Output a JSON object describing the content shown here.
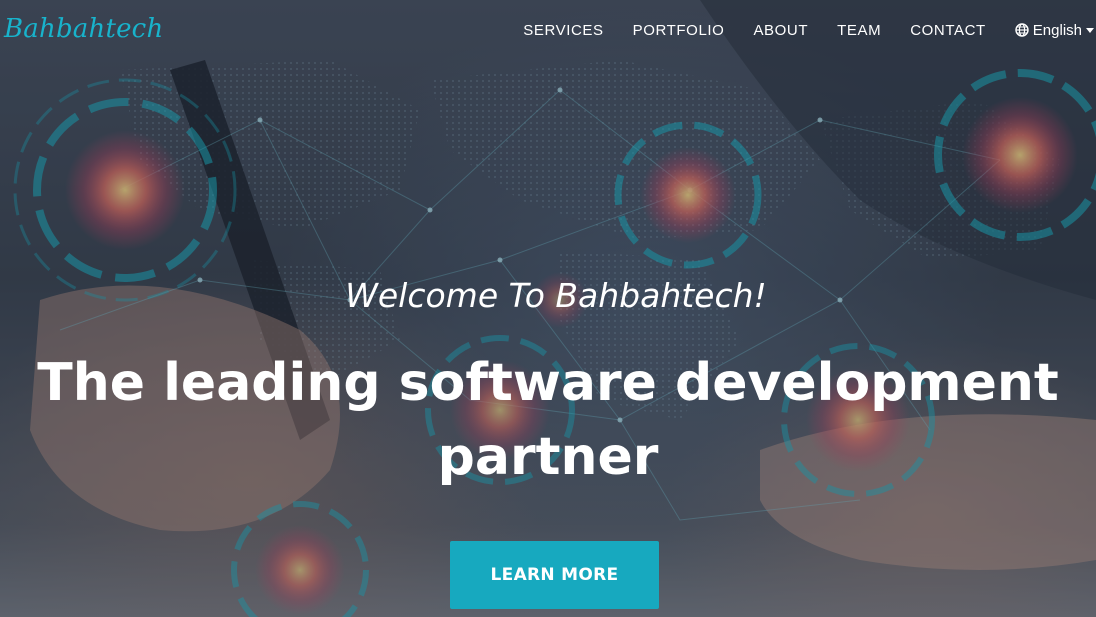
{
  "brand": {
    "logo_text": "Bahbahtech",
    "logo_color": "#18b3cc"
  },
  "nav": {
    "items": [
      {
        "label": "SERVICES"
      },
      {
        "label": "PORTFOLIO"
      },
      {
        "label": "ABOUT"
      },
      {
        "label": "TEAM"
      },
      {
        "label": "CONTACT"
      }
    ],
    "language": {
      "label": "English",
      "icon": "globe-icon",
      "caret_icon": "caret-down-icon"
    }
  },
  "hero": {
    "welcome": "Welcome To Bahbahtech!",
    "headline": "The leading software development partner",
    "cta_label": "LEARN MORE",
    "cta_color": "#17a9bf",
    "background_theme": "business person writing with digital world map network overlay and glowing circular HUD rings"
  }
}
